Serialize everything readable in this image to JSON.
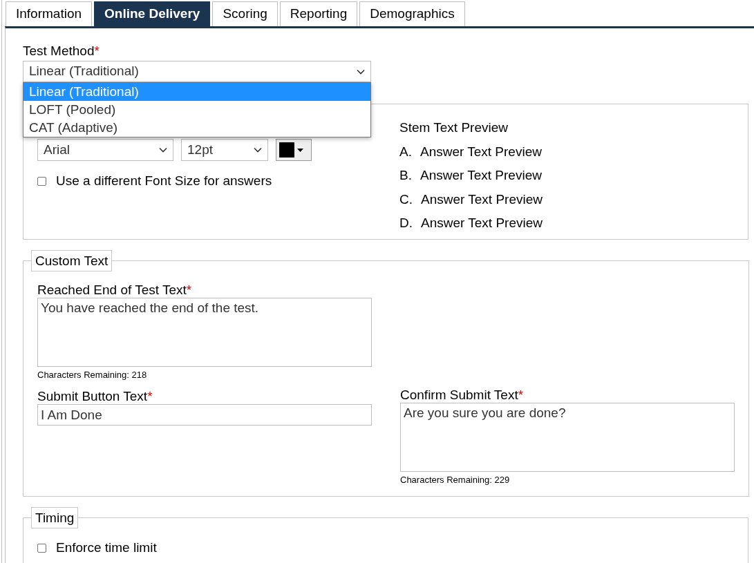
{
  "tabs": [
    {
      "label": "Information",
      "selected": false
    },
    {
      "label": "Online Delivery",
      "selected": true
    },
    {
      "label": "Scoring",
      "selected": false
    },
    {
      "label": "Reporting",
      "selected": false
    },
    {
      "label": "Demographics",
      "selected": false
    }
  ],
  "test_method": {
    "label": "Test Method",
    "required_mark": "*",
    "value": "Linear (Traditional)",
    "expanded": true,
    "options": [
      {
        "label": "Linear (Traditional)",
        "selected": true
      },
      {
        "label": "LOFT (Pooled)",
        "selected": false
      },
      {
        "label": "CAT (Adaptive)",
        "selected": false
      }
    ]
  },
  "appearance": {
    "font": {
      "value": "Arial"
    },
    "font_size": {
      "value": "12pt"
    },
    "font_color": {
      "color": "#000000"
    },
    "different_answer_size": {
      "label": "Use a different Font Size for answers",
      "checked": false
    },
    "preview": {
      "stem": "Stem Text Preview",
      "answers": [
        {
          "letter": "A.",
          "text": "Answer Text Preview"
        },
        {
          "letter": "B.",
          "text": "Answer Text Preview"
        },
        {
          "letter": "C.",
          "text": "Answer Text Preview"
        },
        {
          "letter": "D.",
          "text": "Answer Text Preview"
        }
      ]
    }
  },
  "custom_text": {
    "legend": "Custom Text",
    "end_text": {
      "label": "Reached End of Test Text",
      "required_mark": "*",
      "value": "You have reached the end of the test.",
      "remaining": "Characters Remaining: 218"
    },
    "submit_text": {
      "label": "Submit Button Text",
      "required_mark": "*",
      "value": "I Am Done"
    },
    "confirm_text": {
      "label": "Confirm Submit Text",
      "required_mark": "*",
      "value": "Are you sure you are done?",
      "remaining": "Characters Remaining: 229"
    }
  },
  "timing": {
    "legend": "Timing",
    "enforce_limit": {
      "label": "Enforce time limit",
      "checked": false
    }
  }
}
